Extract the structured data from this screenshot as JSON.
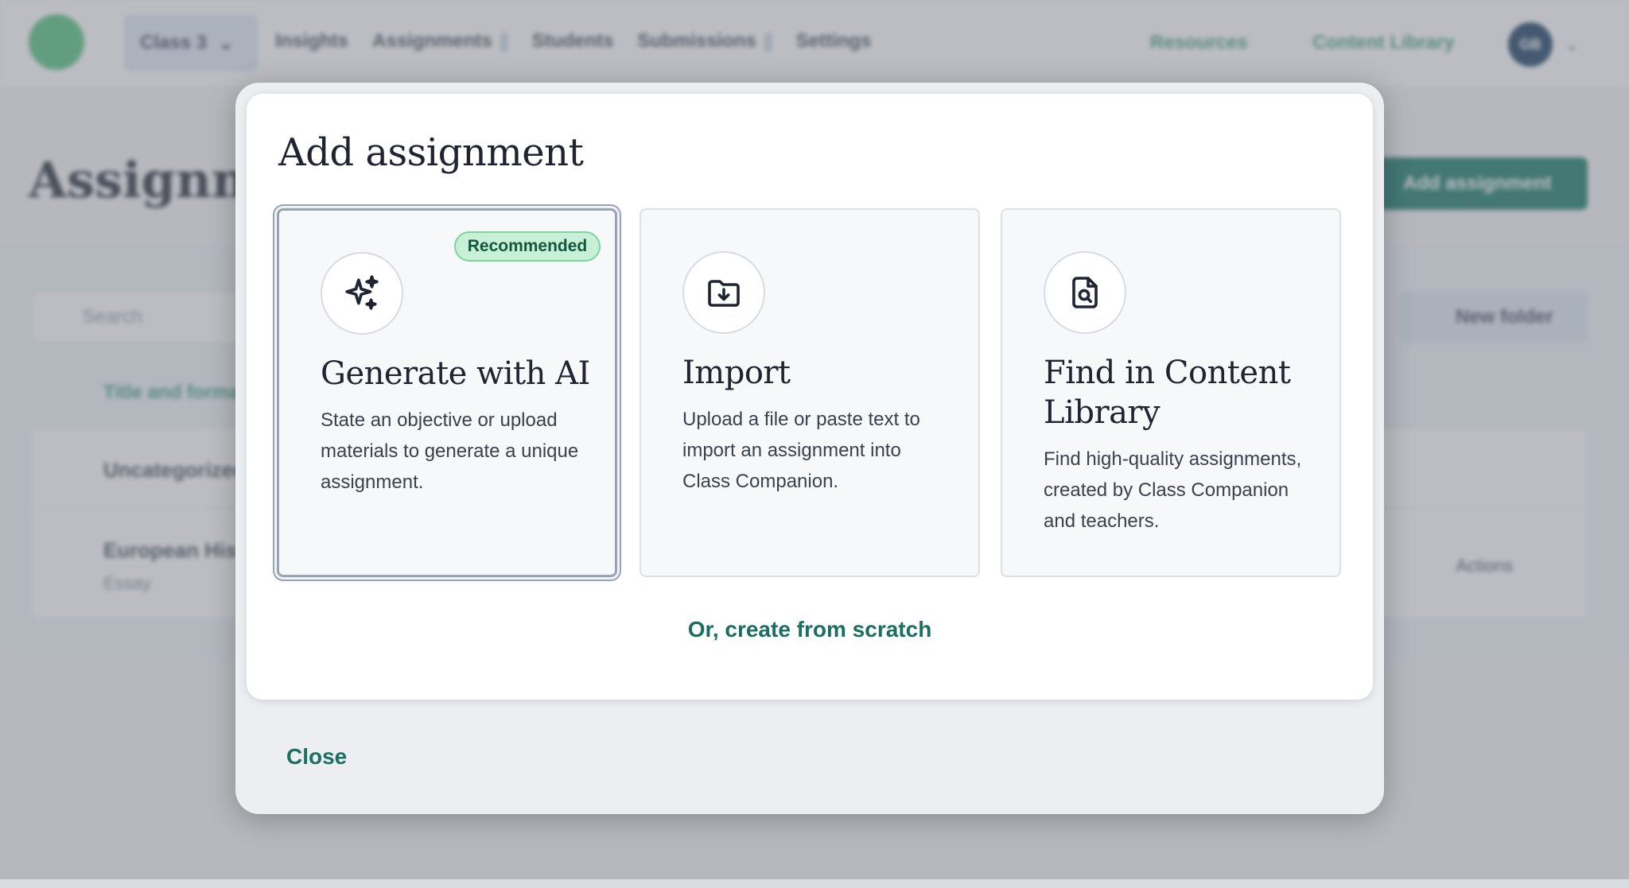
{
  "app": {
    "class_select": "Class 3",
    "nav": [
      {
        "label": "Insights"
      },
      {
        "label": "Assignments"
      },
      {
        "label": "Students"
      },
      {
        "label": "Submissions"
      },
      {
        "label": "Settings"
      }
    ],
    "resources": "Resources",
    "content_library": "Content Library",
    "avatar_initials": "GB",
    "page_title": "Assignments",
    "add_assignment": "Add assignment",
    "search_placeholder": "Search",
    "new_folder": "New folder",
    "column_header": "Title and format",
    "group_label": "Uncategorized",
    "row": {
      "title": "European History",
      "subtitle": "Essay",
      "actions": "Actions"
    }
  },
  "modal": {
    "title": "Add assignment",
    "options": [
      {
        "title": "Generate with AI",
        "description": "State an objective or upload materials to generate a unique assignment.",
        "badge": "Recommended",
        "icon": "sparkles-icon"
      },
      {
        "title": "Import",
        "description": "Upload a file or paste text to import an assignment into Class Companion.",
        "icon": "folder-download-icon"
      },
      {
        "title": "Find in Content Library",
        "description": "Find high-quality assignments, created by Class Companion and teachers.",
        "icon": "file-search-icon"
      }
    ],
    "scratch_link": "Or, create from scratch",
    "close": "Close"
  },
  "colors": {
    "accent": "#1b6e63",
    "badge_bg": "#c7f0d7",
    "primary_button": "#0f7562"
  }
}
